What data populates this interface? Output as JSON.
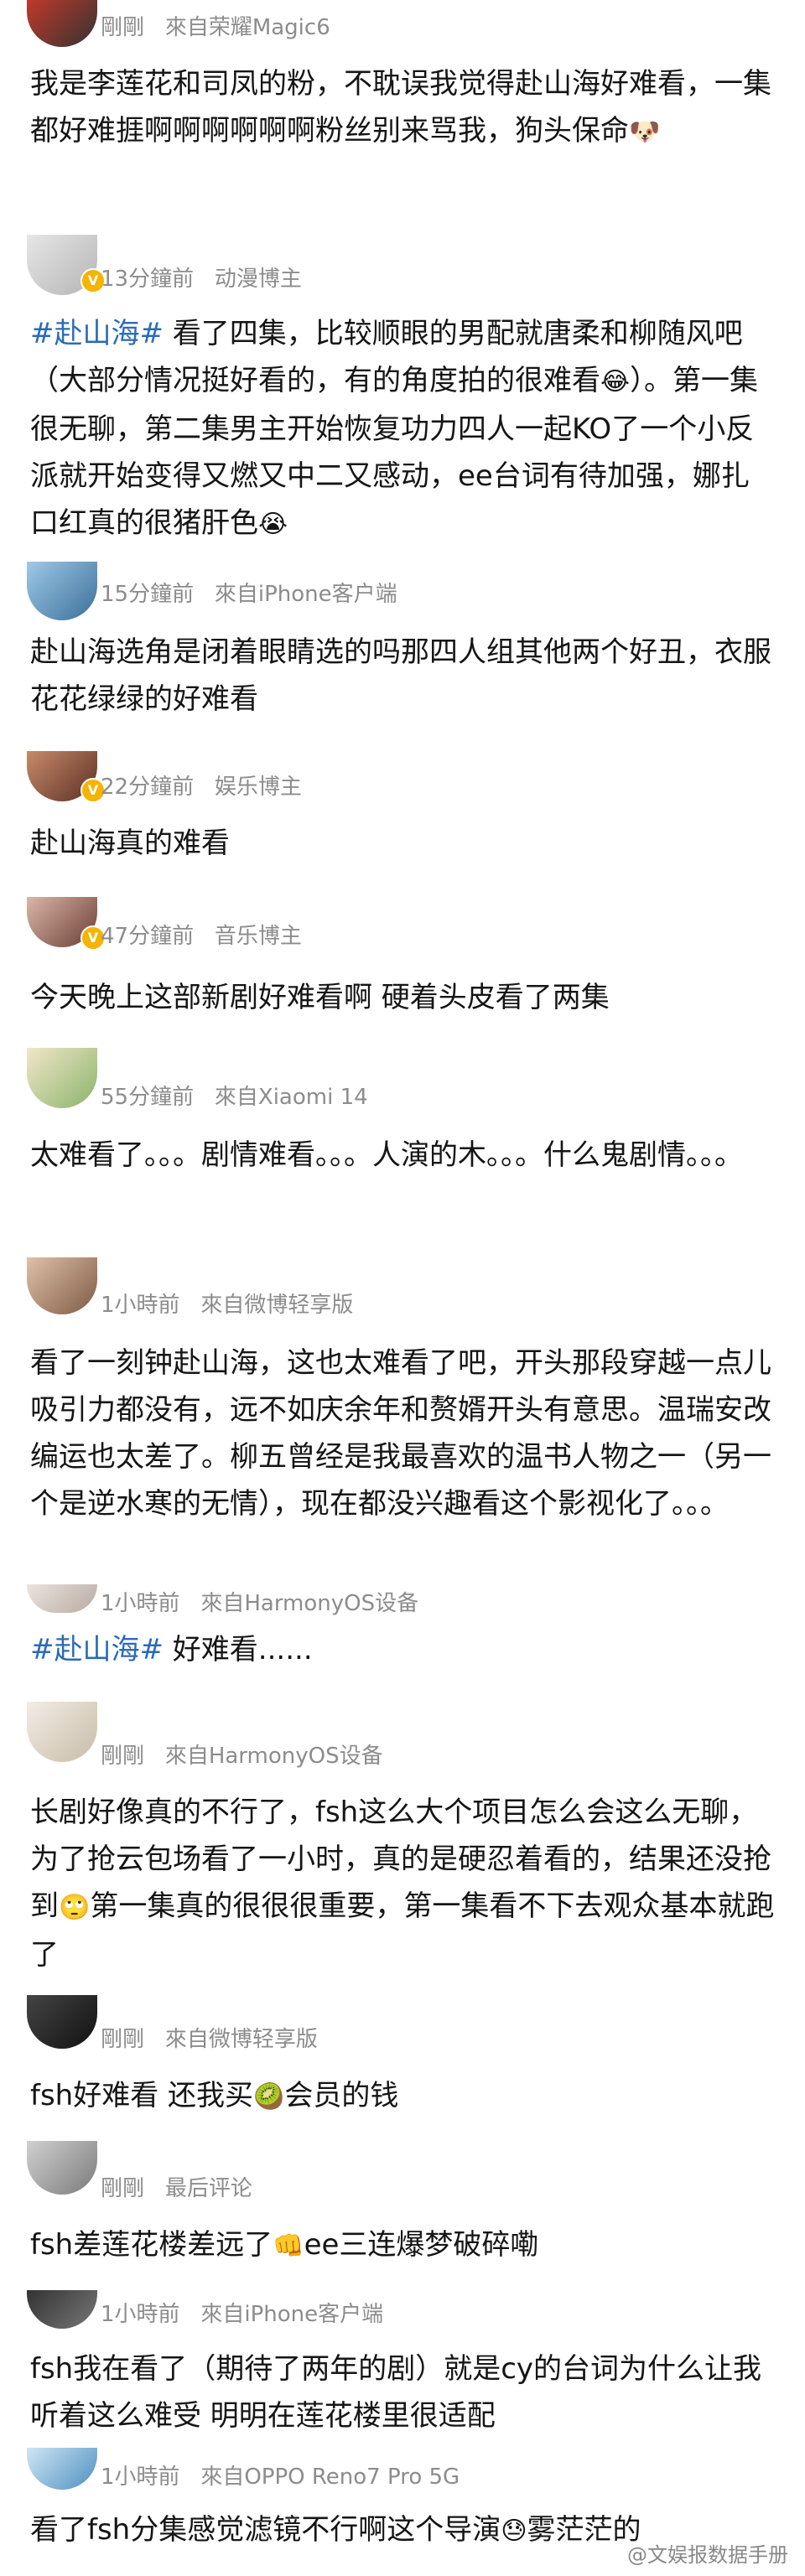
{
  "posts": [
    {
      "time": "剛剛",
      "source": "來自荣耀Magic6",
      "text": "我是李莲花和司凤的粉，不耽误我觉得赴山海好难看，一集都好难捱啊啊啊啊啊啊粉丝别来骂我，狗头保命",
      "emoji": "🐶"
    },
    {
      "time": "13分鐘前",
      "source": "动漫博主",
      "hashtag": "#赴山海#",
      "text": " 看了四集，比较顺眼的男配就唐柔和柳随风吧（大部分情况挺好看的，有的角度拍的很难看",
      "emoji": "😂",
      "text2": "）。第一集很无聊，第二集男主开始恢复功力四人一起KO了一个小反派就开始变得又燃又中二又感动，ee台词有待加强，娜扎口红真的很猪肝色",
      "emoji2": "😭"
    },
    {
      "time": "15分鐘前",
      "source": "來自iPhone客户端",
      "text": "赴山海选角是闭着眼睛选的吗那四人组其他两个好丑，衣服花花绿绿的好难看"
    },
    {
      "time": "22分鐘前",
      "source": "娱乐博主",
      "text": "赴山海真的难看"
    },
    {
      "time": "47分鐘前",
      "source": "音乐博主",
      "text": "今天晚上这部新剧好难看啊 硬着头皮看了两集"
    },
    {
      "time": "55分鐘前",
      "source": "來自Xiaomi 14",
      "text": "太难看了。。。剧情难看。。。人演的木。。。什么鬼剧情。。。"
    },
    {
      "time": "1小時前",
      "source": "來自微博轻享版",
      "text": "看了一刻钟赴山海，这也太难看了吧，开头那段穿越一点儿吸引力都没有，远不如庆余年和赘婿开头有意思。温瑞安改编运也太差了。柳五曾经是我最喜欢的温书人物之一（另一个是逆水寒的无情），现在都没兴趣看这个影视化了。。。"
    },
    {
      "time": "1小時前",
      "source": "來自HarmonyOS设备",
      "hashtag": "#赴山海#",
      "text": " 好难看......"
    },
    {
      "time": "剛剛",
      "source": "來自HarmonyOS设备",
      "text": "长剧好像真的不行了，fsh这么大个项目怎么会这么无聊，为了抢云包场看了一小时，真的是硬忍着看的，结果还没抢到",
      "emoji": "🙄",
      "text2": "第一集真的很很很重要，第一集看不下去观众基本就跑了"
    },
    {
      "time": "剛剛",
      "source": "來自微博轻享版",
      "text": "fsh好难看 还我买",
      "emoji": "🥝",
      "text2": "会员的钱"
    },
    {
      "time": "剛剛",
      "source": "最后评论",
      "text": "fsh差莲花楼差远了",
      "emoji": "👊",
      "text2": "ee三连爆梦破碎嘞"
    },
    {
      "time": "1小時前",
      "source": "來自iPhone客户端",
      "text": "fsh我在看了（期待了两年的剧）就是cy的台词为什么让我听着这么难受 明明在莲花楼里很适配"
    },
    {
      "time": "1小時前",
      "source": "來自OPPO Reno7 Pro 5G",
      "text": "看了fsh分集感觉滤镜不行啊这个导演",
      "emoji": "😓",
      "text2": "雾茫茫的"
    }
  ],
  "watermark": "@文娱报数据手册"
}
